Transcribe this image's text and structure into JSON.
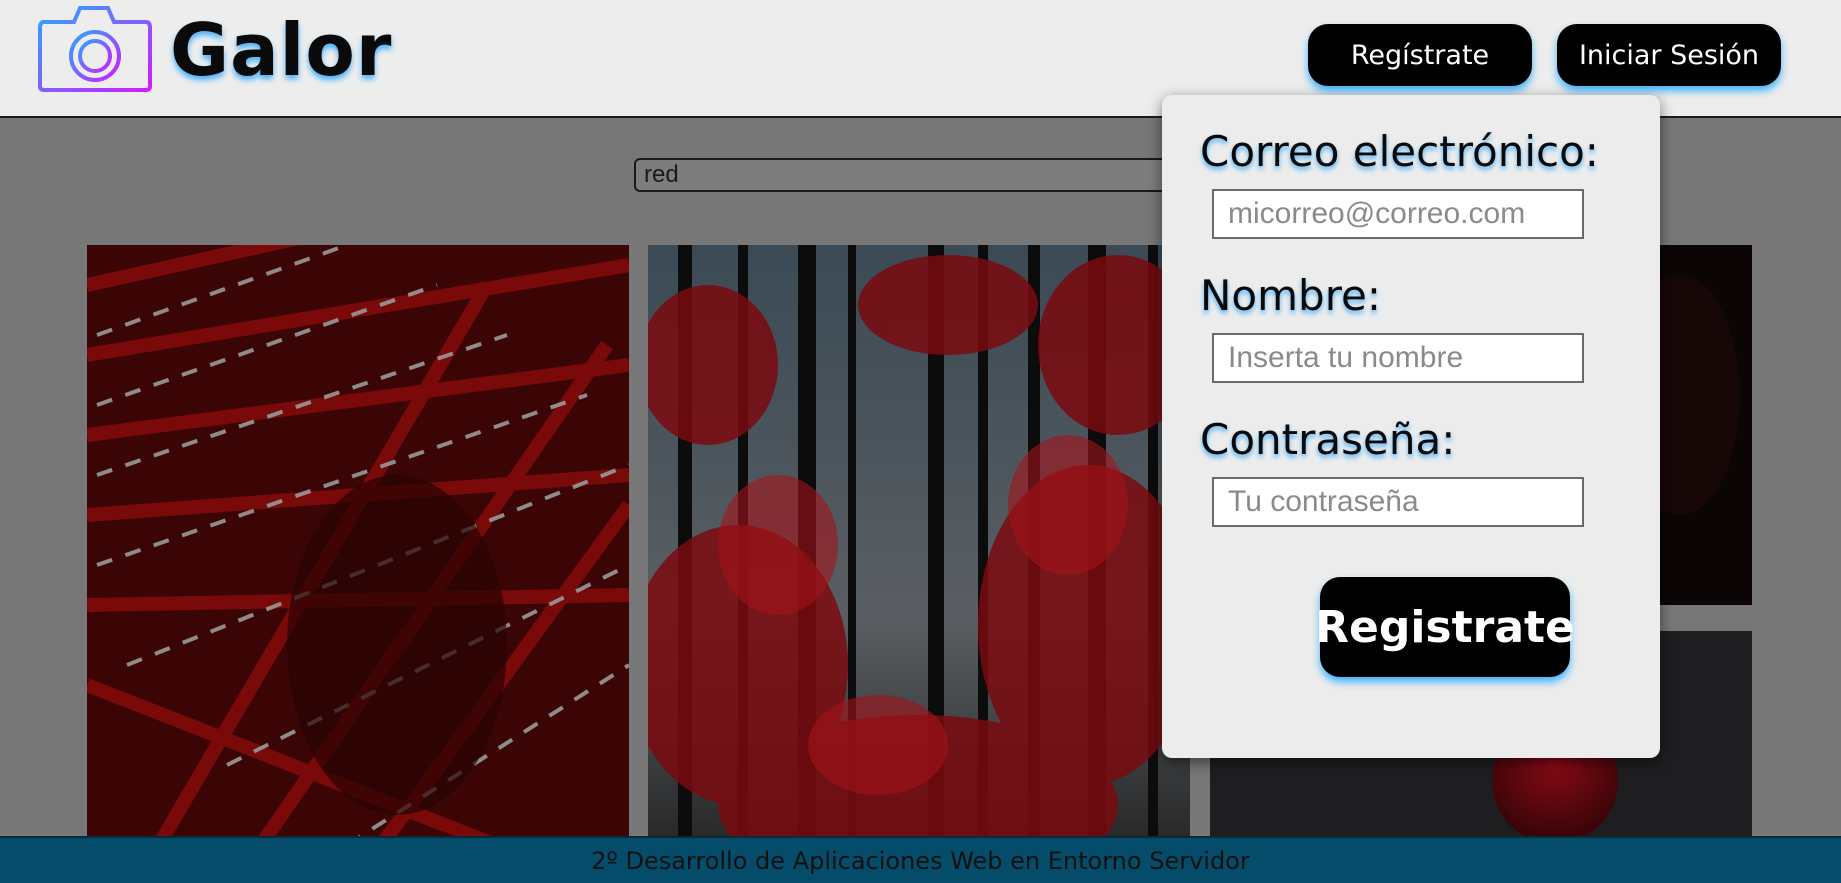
{
  "header": {
    "brand": "Galor",
    "register_label": "Regístrate",
    "login_label": "Iniciar Sesión"
  },
  "search": {
    "value": "red"
  },
  "modal": {
    "email_label": "Correo electrónico:",
    "email_placeholder": "micorreo@correo.com",
    "name_label": "Nombre:",
    "name_placeholder": "Inserta tu nombre",
    "password_label": "Contraseña:",
    "password_placeholder": "Tu contraseña",
    "submit_label": "Registrate"
  },
  "footer": {
    "text": "2º Desarrollo de Aplicaciones Web en Entorno Servidor"
  },
  "colors": {
    "header_bg": "#ededed",
    "overlay": "#777777",
    "footer_bg": "#054c6a",
    "button_bg": "#000000",
    "glow": "#1ea0ff"
  },
  "icons": [
    "camera-logo-icon"
  ],
  "photos": [
    "red-laser-portrait-photo",
    "red-forest-photo",
    "dark-photo",
    "red-sphere-photo"
  ]
}
